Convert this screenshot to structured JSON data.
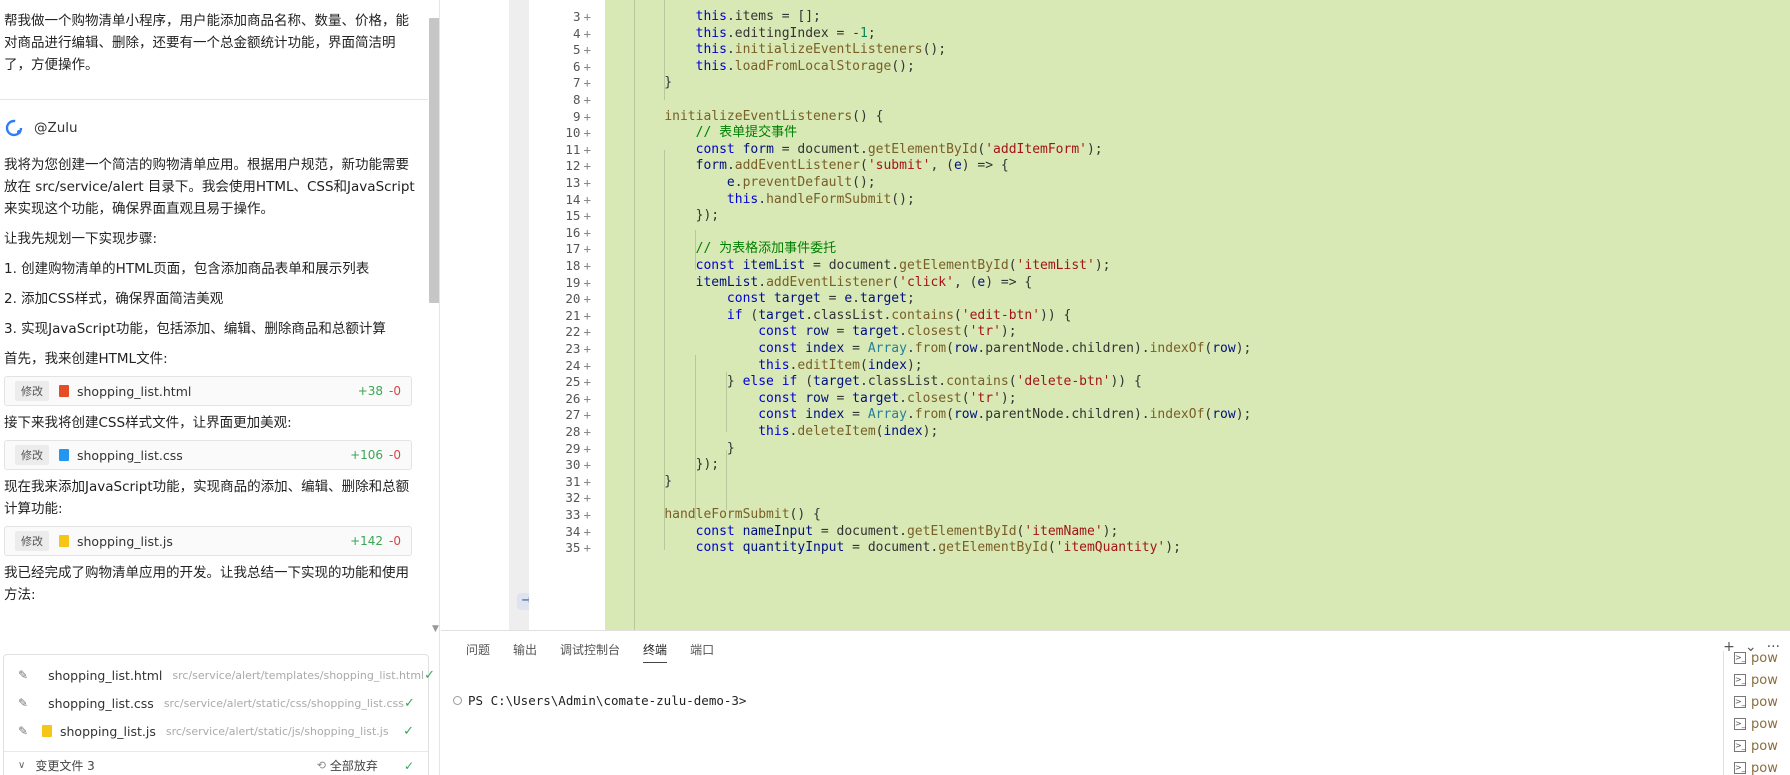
{
  "chat": {
    "user_message": "帮我做一个购物清单小程序，用户能添加商品名称、数量、价格，能对商品进行编辑、删除，还要有一个总金额统计功能，界面简洁明了，方便操作。",
    "agent_name": "@Zulu",
    "intro": "我将为您创建一个简洁的购物清单应用。根据用户规范，新功能需要放在 src/service/alert 目录下。我会使用HTML、CSS和JavaScript来实现这个功能，确保界面直观且易于操作。",
    "plan_title": "让我先规划一下实现步骤:",
    "steps": [
      "1. 创建购物清单的HTML页面，包含添加商品表单和展示列表",
      "2. 添加CSS样式，确保界面简洁美观",
      "3. 实现JavaScript功能，包括添加、编辑、删除商品和总额计算"
    ],
    "step_html": "首先，我来创建HTML文件:",
    "step_css": "接下来我将创建CSS样式文件，让界面更加美观:",
    "step_js": "现在我来添加JavaScript功能，实现商品的添加、编辑、删除和总额计算功能:",
    "conclusion": "我已经完成了购物清单应用的开发。让我总结一下实现的功能和使用方法:",
    "modify_label": "修改",
    "file_cards": [
      {
        "name": "shopping_list.html",
        "added": "+38",
        "removed": "-0"
      },
      {
        "name": "shopping_list.css",
        "added": "+106",
        "removed": "-0"
      },
      {
        "name": "shopping_list.js",
        "added": "+142",
        "removed": "-0"
      }
    ]
  },
  "changed_files": {
    "rows": [
      {
        "name": "shopping_list.html",
        "path": "src/service/alert/templates/shopping_list.html"
      },
      {
        "name": "shopping_list.css",
        "path": "src/service/alert/static/css/shopping_list.css"
      },
      {
        "name": "shopping_list.js",
        "path": "src/service/alert/static/js/shopping_list.js"
      }
    ],
    "footer_label": "变更文件 3",
    "discard_label": "全部放弃"
  },
  "editor": {
    "collapse_glyph": "→",
    "lines": [
      {
        "num": "3",
        "code": "        this.items = [];"
      },
      {
        "num": "4",
        "code": "        this.editingIndex = -1;"
      },
      {
        "num": "5",
        "code": "        this.initializeEventListeners();"
      },
      {
        "num": "6",
        "code": "        this.loadFromLocalStorage();"
      },
      {
        "num": "7",
        "code": "    }"
      },
      {
        "num": "8",
        "code": ""
      },
      {
        "num": "9",
        "code": "    initializeEventListeners() {"
      },
      {
        "num": "10",
        "code": "        // 表单提交事件"
      },
      {
        "num": "11",
        "code": "        const form = document.getElementById('addItemForm');"
      },
      {
        "num": "12",
        "code": "        form.addEventListener('submit', (e) => {"
      },
      {
        "num": "13",
        "code": "            e.preventDefault();"
      },
      {
        "num": "14",
        "code": "            this.handleFormSubmit();"
      },
      {
        "num": "15",
        "code": "        });"
      },
      {
        "num": "16",
        "code": ""
      },
      {
        "num": "17",
        "code": "        // 为表格添加事件委托"
      },
      {
        "num": "18",
        "code": "        const itemList = document.getElementById('itemList');"
      },
      {
        "num": "19",
        "code": "        itemList.addEventListener('click', (e) => {"
      },
      {
        "num": "20",
        "code": "            const target = e.target;"
      },
      {
        "num": "21",
        "code": "            if (target.classList.contains('edit-btn')) {"
      },
      {
        "num": "22",
        "code": "                const row = target.closest('tr');"
      },
      {
        "num": "23",
        "code": "                const index = Array.from(row.parentNode.children).indexOf(row);"
      },
      {
        "num": "24",
        "code": "                this.editItem(index);"
      },
      {
        "num": "25",
        "code": "            } else if (target.classList.contains('delete-btn')) {"
      },
      {
        "num": "26",
        "code": "                const row = target.closest('tr');"
      },
      {
        "num": "27",
        "code": "                const index = Array.from(row.parentNode.children).indexOf(row);"
      },
      {
        "num": "28",
        "code": "                this.deleteItem(index);"
      },
      {
        "num": "29",
        "code": "            }"
      },
      {
        "num": "30",
        "code": "        });"
      },
      {
        "num": "31",
        "code": "    }"
      },
      {
        "num": "32",
        "code": ""
      },
      {
        "num": "33",
        "code": "    handleFormSubmit() {"
      },
      {
        "num": "34",
        "code": "        const nameInput = document.getElementById('itemName');"
      },
      {
        "num": "35",
        "code": "        const quantityInput = document.getElementById('itemQuantity');"
      }
    ]
  },
  "terminal": {
    "tabs": [
      "问题",
      "输出",
      "调试控制台",
      "终端",
      "端口"
    ],
    "active_tab": "终端",
    "prompt": "PS C:\\Users\\Admin\\comate-zulu-demo-3>",
    "new_terminal_glyph": "+",
    "more_glyph": "···",
    "instances": [
      "pow",
      "pow",
      "pow",
      "pow",
      "pow",
      "pow"
    ]
  }
}
